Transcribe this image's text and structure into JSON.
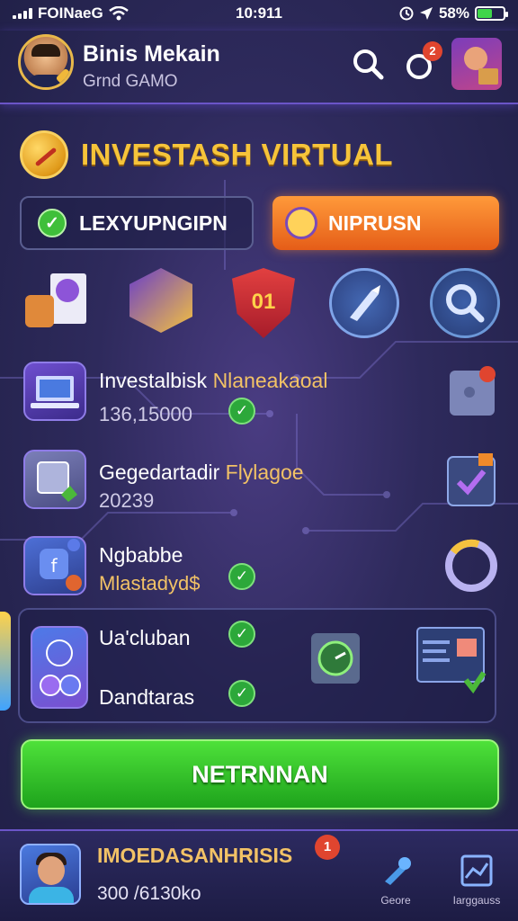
{
  "status_bar": {
    "carrier": "FOINaeG",
    "time": "10:911",
    "battery": "58%",
    "battery_level": 0.58
  },
  "header": {
    "name": "Binis Mekain",
    "subtitle": "Grnd GAMO",
    "notification_count": "2",
    "icons": [
      "user-avatar",
      "search-icon",
      "bell-icon",
      "hero-avatar"
    ]
  },
  "title": "INVESTASH VIRTUAL",
  "buttons": {
    "outline_label": "LEXYUPNGIPN",
    "orange_label": "NIPRUSN"
  },
  "icon_strip": [
    "document-lock-icon",
    "hexagon-gem-icon",
    "shield-icon",
    "rocket-icon",
    "magnifier-icon"
  ],
  "shield_number": "01",
  "rows": [
    {
      "title": "Investalbisk ",
      "highlight": "Nlaneakaoal",
      "value": "136,15000"
    },
    {
      "title": "Gegedartadir ",
      "highlight": "Flylagoe",
      "value": "20239"
    },
    {
      "title": "Ngbabbe",
      "highlight": "",
      "value": "Mlastadyd$"
    }
  ],
  "panel": {
    "line1": "Ua'cluban",
    "line2": "Dandtaras"
  },
  "cta_label": "NETRNNAN",
  "bottom_bar": {
    "title": "IMOEDASANHRISIS",
    "value": "300 /6130ko",
    "notification_count": "1",
    "nav": [
      {
        "label": "Geore",
        "icon": "wrench-icon"
      },
      {
        "label": "Iarggauss",
        "icon": "chart-icon"
      }
    ]
  },
  "colors": {
    "accent_gold": "#f6c43a",
    "cta_green": "#1ea31c",
    "orange": "#e55d18",
    "background": "#2e2a5c"
  }
}
